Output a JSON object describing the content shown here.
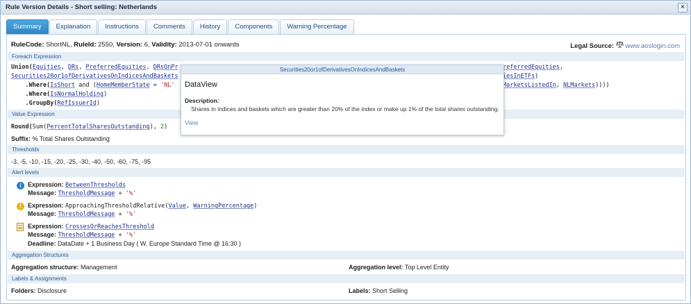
{
  "window": {
    "title": "Rule Version Details - Short selling: Netherlands",
    "close": "×"
  },
  "tabs": [
    "Summary",
    "Explanation",
    "Instructions",
    "Comments",
    "History",
    "Components",
    "Warning Percentage"
  ],
  "header": {
    "rulecode_label": "RuleCode:",
    "rulecode": "ShortNL,",
    "ruleid_label": "RuleId:",
    "ruleid": "2550,",
    "version_label": "Version:",
    "version": "6,",
    "validity_label": "Validity:",
    "validity": "2013-07-01 onwards",
    "legal_label": "Legal Source:",
    "legal_icon": "scales-icon",
    "legal_link": "www.aoslogin.com"
  },
  "foreach": {
    "section": "Foreach Expression",
    "l1a": "Union(",
    "l1b": "Equities",
    "l1c": ", ",
    "l1d": "DRs",
    "l1e": ", ",
    "l1f": "PreferredEquities",
    "l1g": ", ",
    "l1h": "DRsOnPr",
    "l1r": "referredEquities",
    "l1s": ",",
    "l2a": "Securities20or1ofDerivativesOnIndicesAndBaskets",
    "l2r": "iesInETFs",
    "l2s": ")",
    "l3a": "    .Where(",
    "l3b": "IsShort",
    "l3c": " and (",
    "l3d": "HomeMemberState",
    "l3e": " = ",
    "l3f": "'NL'",
    "l3r": "MarketsListedIn",
    "l3s": ", ",
    "l3t": "NLMarkets",
    "l3u": "))))",
    "l4a": "    .Where(",
    "l4b": "IsNormalHolding",
    "l4c": ")",
    "l5a": "    .GroupBy(",
    "l5b": "RefIssuerId",
    "l5c": ")"
  },
  "value": {
    "section": "Value Expression",
    "e1": "Round(",
    "e2": "Sum(",
    "e3": "PercentTotalSharesOutstanding",
    "e4": "), ",
    "e5": "2",
    "e6": ")",
    "suffix_label": "Suffix:",
    "suffix": "% Total Shares Outstanding"
  },
  "thresholds": {
    "section": "Thresholds",
    "values": "-3, -5, -10, -15, -20, -25, -30, -40, -50, -60, -75, -95"
  },
  "alerts": {
    "section": "Alert levels",
    "expr_label": "Expression:",
    "msg_label": "Message:",
    "a1_icon": "info-icon",
    "a1_expr": "BetweenThresholds",
    "a1_msg": "ThresholdMessage",
    "a1_plus": " + ",
    "a1_str": "'%'",
    "a2_icon": "warning-icon",
    "a2_expr_a": "ApproachingThresholdRelative(",
    "a2_expr_b": "Value",
    "a2_expr_c": ", ",
    "a2_expr_d": "WarningPercentage",
    "a2_expr_e": ")",
    "a2_msg": "ThresholdMessage",
    "a2_plus": " + ",
    "a2_str": "'%'",
    "a3_icon": "document-icon",
    "a3_expr": "CrossesOrReachesThreshold",
    "a3_msg": "ThresholdMessage",
    "a3_plus": " + ",
    "a3_str": "'%'",
    "deadline_label": "Deadline:",
    "deadline": "DataDate + 1 Business Day ( W. Europe Standard Time @ 16:30 )"
  },
  "aggregation": {
    "section": "Aggregation Structures",
    "structure_label": "Aggregation structure:",
    "structure": "Management",
    "level_label": "Aggregation level:",
    "level": "Top Level Entity"
  },
  "labels": {
    "section": "Labels & Assignments",
    "folders_label": "Folders:",
    "folders": "Disclosure",
    "labels_label": "Labels:",
    "labels": "Short Selling"
  },
  "popup": {
    "header": "Securities20or1ofDerivativesOnIndicesAndBaskets",
    "title": "DataView",
    "desc_label": "Description:",
    "desc": "Shares in indices and baskets which are greater than 20% of the index or make up 1% of the total shares outstanding.",
    "link": "View"
  }
}
